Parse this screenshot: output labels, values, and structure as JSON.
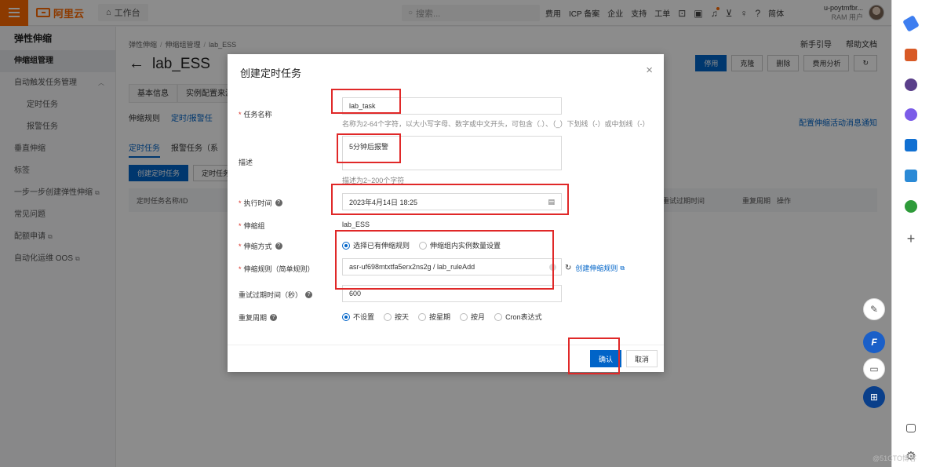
{
  "topbar": {
    "logo_text": "阿里云",
    "workbench": "工作台",
    "search_placeholder": "搜索...",
    "nav": [
      "费用",
      "ICP 备案",
      "企业",
      "支持",
      "工单"
    ],
    "lang": "简体",
    "user_name": "u-poytmfbr...",
    "user_role": "RAM 用户"
  },
  "sidebar": {
    "title": "弹性伸缩",
    "items": [
      {
        "label": "伸缩组管理",
        "active": true
      },
      {
        "label": "自动触发任务管理"
      },
      {
        "label": "定时任务",
        "sub": true
      },
      {
        "label": "报警任务",
        "sub": true
      },
      {
        "label": "垂直伸缩"
      },
      {
        "label": "标签"
      },
      {
        "label": "一步一步创建弹性伸缩"
      },
      {
        "label": "常见问题"
      },
      {
        "label": "配额申请"
      },
      {
        "label": "自动化运维 OOS"
      }
    ]
  },
  "main": {
    "breadcrumb": [
      "弹性伸缩",
      "伸缩组管理",
      "lab_ESS"
    ],
    "help_links": [
      "新手引导",
      "帮助文档"
    ],
    "title": "lab_ESS",
    "top_buttons": [
      "停用",
      "克隆",
      "删除",
      "费用分析"
    ],
    "tabs": [
      "基本信息",
      "实例配置来源"
    ],
    "sub_tabs": [
      "伸缩规则",
      "定时/报警任"
    ],
    "notify_link": "配置伸缩活动消息通知",
    "third_tabs": [
      "定时任务",
      "报警任务（系"
    ],
    "actions": [
      "创建定时任务",
      "定时任务ID"
    ],
    "table_headers": [
      "定时任务名称/ID",
      "重试过期时间",
      "重复周期",
      "操作"
    ]
  },
  "modal": {
    "title": "创建定时任务",
    "fields": {
      "task_name_label": "任务名称",
      "task_name_value": "lab_task",
      "task_name_hint": "名称为2-64个字符，以大小写字母、数字或中文开头，可包含（.）、（_）下划线（-）或中划线（-）",
      "desc_label": "描述",
      "desc_value": "5分钟后报警",
      "desc_hint": "描述为2~200个字符",
      "exec_time_label": "执行时间",
      "exec_time_value": "2023年4月14日 18:25",
      "group_label": "伸缩组",
      "group_value": "lab_ESS",
      "method_label": "伸缩方式",
      "method_options": [
        "选择已有伸缩规则",
        "伸缩组内实例数量设置"
      ],
      "rule_label": "伸缩规则（简单规则）",
      "rule_value": "asr-uf698mtxtfa5erx2ns2g / lab_ruleAdd",
      "create_rule_link": "创建伸缩规则",
      "retry_label": "重试过期时间（秒）",
      "retry_value": "600",
      "repeat_label": "重复周期",
      "repeat_options": [
        "不设置",
        "按天",
        "按星期",
        "按月",
        "Cron表达式"
      ]
    },
    "confirm": "确认",
    "cancel": "取消"
  },
  "watermark": "@51CTO博客",
  "colors": {
    "brand": "#ff6a00",
    "primary": "#0064c8",
    "annotation": "#e02828"
  }
}
